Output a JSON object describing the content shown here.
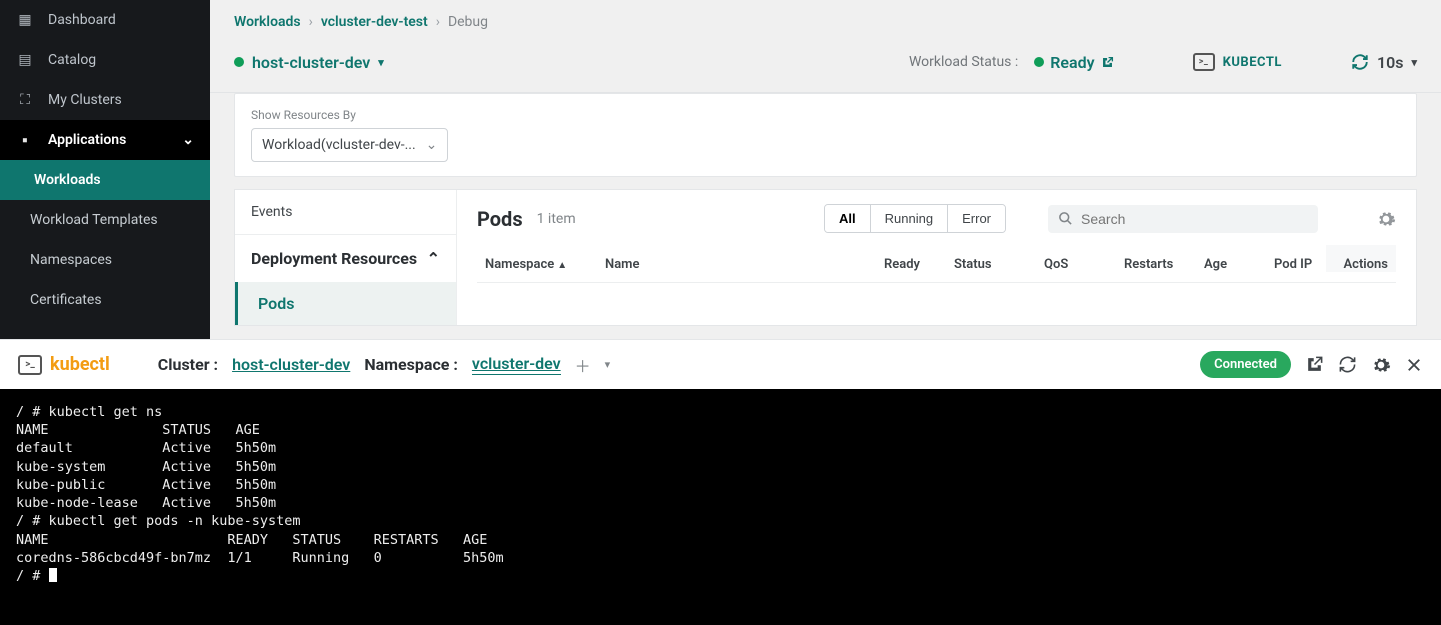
{
  "sidebar": {
    "items": [
      {
        "label": "Dashboard"
      },
      {
        "label": "Catalog"
      },
      {
        "label": "My Clusters"
      },
      {
        "label": "Applications"
      }
    ],
    "sub": [
      {
        "label": "Workloads"
      },
      {
        "label": "Workload Templates"
      },
      {
        "label": "Namespaces"
      },
      {
        "label": "Certificates"
      }
    ]
  },
  "breadcrumb": {
    "a": "Workloads",
    "b": "vcluster-dev-test",
    "c": "Debug"
  },
  "context": {
    "cluster": "host-cluster-dev",
    "status_label": "Workload Status :",
    "status_value": "Ready",
    "kubectl": "KUBECTL",
    "interval": "10s"
  },
  "filter": {
    "label": "Show Resources By",
    "value": "Workload(vcluster-dev-..."
  },
  "leftpanel": {
    "events": "Events",
    "dr": "Deployment Resources",
    "pods": "Pods"
  },
  "pods": {
    "title": "Pods",
    "count": "1 item",
    "seg": {
      "all": "All",
      "running": "Running",
      "error": "Error"
    },
    "search_placeholder": "Search",
    "cols": {
      "ns": "Namespace",
      "name": "Name",
      "ready": "Ready",
      "status": "Status",
      "qos": "QoS",
      "restarts": "Restarts",
      "age": "Age",
      "ip": "Pod IP",
      "actions": "Actions"
    }
  },
  "termheader": {
    "brand": "kubectl",
    "cluster_label": "Cluster :",
    "cluster": "host-cluster-dev",
    "ns_label": "Namespace :",
    "ns": "vcluster-dev",
    "connected": "Connected"
  },
  "terminal_lines": [
    "/ # kubectl get ns",
    "NAME              STATUS   AGE",
    "default           Active   5h50m",
    "kube-system       Active   5h50m",
    "kube-public       Active   5h50m",
    "kube-node-lease   Active   5h50m",
    "/ # kubectl get pods -n kube-system",
    "NAME                      READY   STATUS    RESTARTS   AGE",
    "coredns-586cbcd49f-bn7mz  1/1     Running   0          5h50m",
    "/ # "
  ]
}
